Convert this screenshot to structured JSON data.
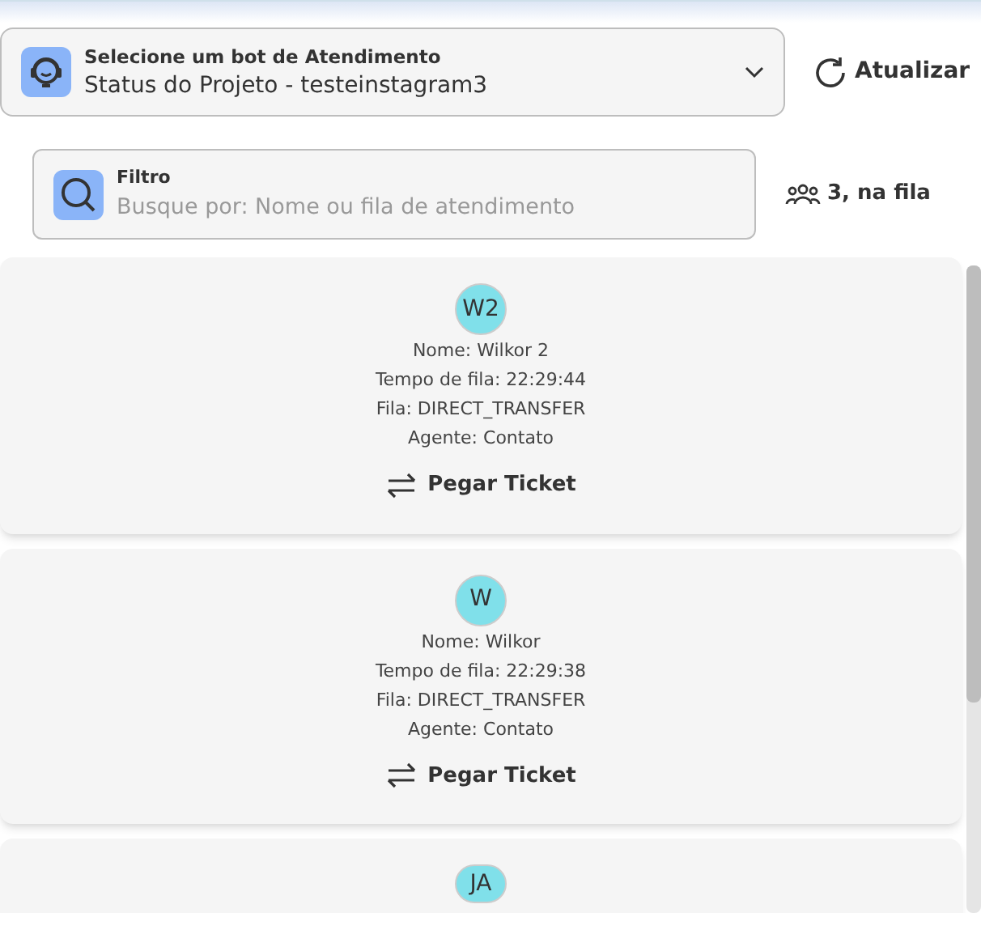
{
  "bot_select": {
    "label": "Selecione um bot de Atendimento",
    "value": "Status do Projeto - testeinstagram3"
  },
  "refresh_button": "Atualizar",
  "filter": {
    "label": "Filtro",
    "placeholder": "Busque por: Nome ou fila de atendimento"
  },
  "queue_count": "3, na fila",
  "tickets": [
    {
      "initials": "W2",
      "lines": [
        "Nome: Wilkor 2",
        "Tempo de fila: 22:29:44",
        "Fila: DIRECT_TRANSFER",
        "Agente: Contato"
      ],
      "action": "Pegar Ticket"
    },
    {
      "initials": "W",
      "lines": [
        "Nome: Wilkor",
        "Tempo de fila: 22:29:38",
        "Fila: DIRECT_TRANSFER",
        "Agente: Contato"
      ],
      "action": "Pegar Ticket"
    },
    {
      "initials": "JA"
    }
  ]
}
